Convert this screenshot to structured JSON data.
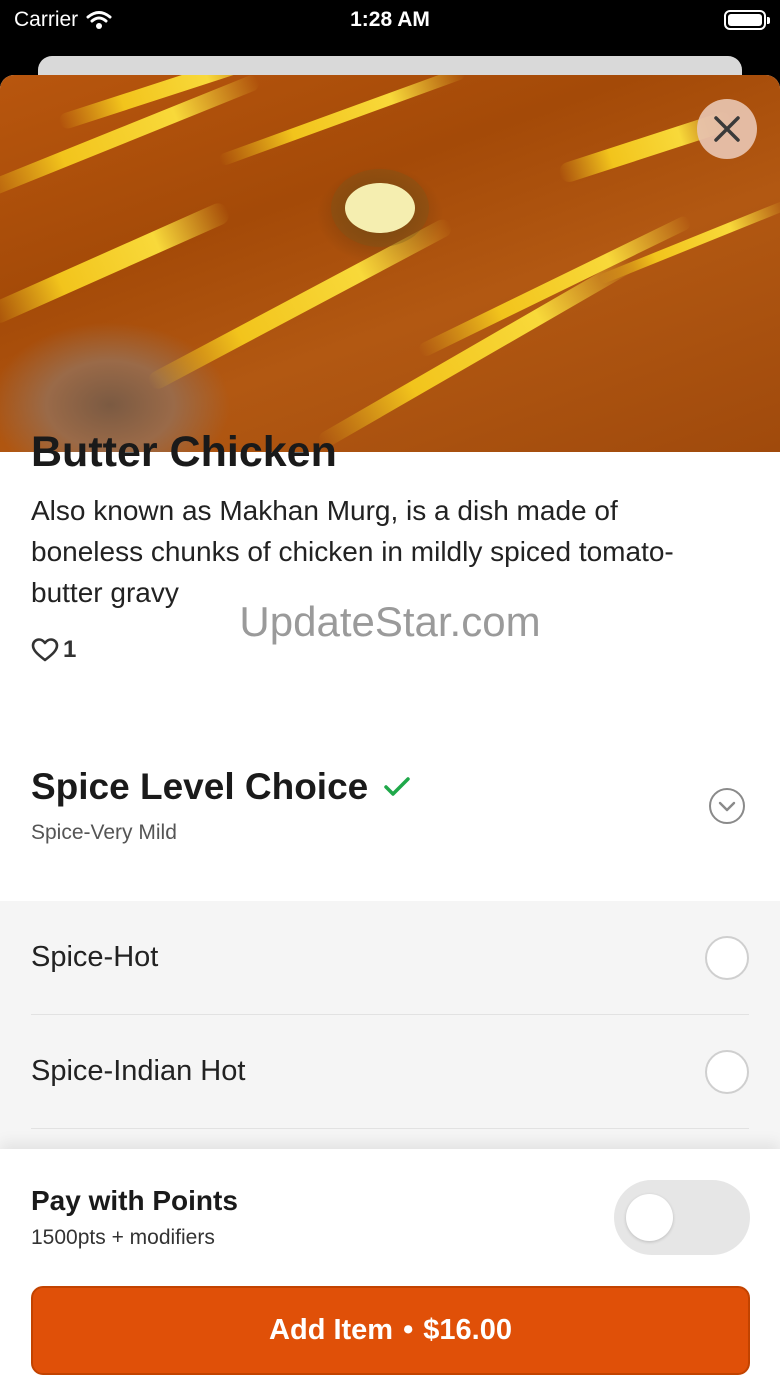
{
  "status_bar": {
    "carrier": "Carrier",
    "time": "1:28 AM"
  },
  "item": {
    "title": "Butter Chicken",
    "description": "Also known as Makhan Murg, is a dish made of boneless chunks of chicken in mildly spiced tomato-butter gravy",
    "likes": "1"
  },
  "watermark": "UpdateStar.com",
  "modifier": {
    "title": "Spice Level Choice",
    "selected": "Spice-Very Mild",
    "options": [
      {
        "label": "Spice-Hot"
      },
      {
        "label": "Spice-Indian Hot"
      }
    ]
  },
  "footer": {
    "points_title": "Pay with Points",
    "points_subtitle": "1500pts + modifiers",
    "points_toggle_on": false,
    "add_label": "Add Item",
    "separator": "•",
    "price": "$16.00"
  },
  "colors": {
    "accent": "#e05008",
    "check": "#1fa84a"
  }
}
